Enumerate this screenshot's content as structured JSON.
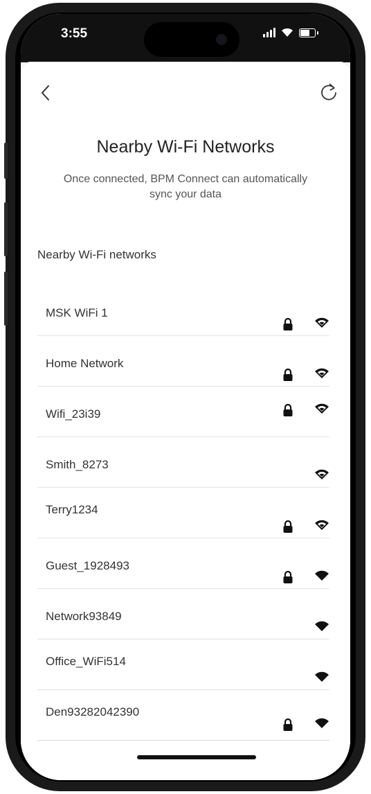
{
  "status": {
    "time": "3:55"
  },
  "header": {
    "title": "Nearby Wi-Fi Networks",
    "subtitle": "Once connected, BPM Connect can automatically sync your data"
  },
  "section_label": "Nearby Wi-Fi networks",
  "networks": [
    {
      "name": "MSK WiFi 1",
      "locked": true
    },
    {
      "name": "Home Network",
      "locked": true
    },
    {
      "name": "Wifi_23i39",
      "locked": true
    },
    {
      "name": "Smith_8273",
      "locked": false
    },
    {
      "name": "Terry1234",
      "locked": true
    },
    {
      "name": "Guest_1928493",
      "locked": true
    },
    {
      "name": "Network93849",
      "locked": false
    },
    {
      "name": "Office_WiFi514",
      "locked": false
    },
    {
      "name": "Den93282042390",
      "locked": true
    }
  ],
  "icons": {
    "back": "chevron-left-icon",
    "refresh": "refresh-icon",
    "lock": "lock-icon",
    "wifi": "wifi-icon"
  }
}
